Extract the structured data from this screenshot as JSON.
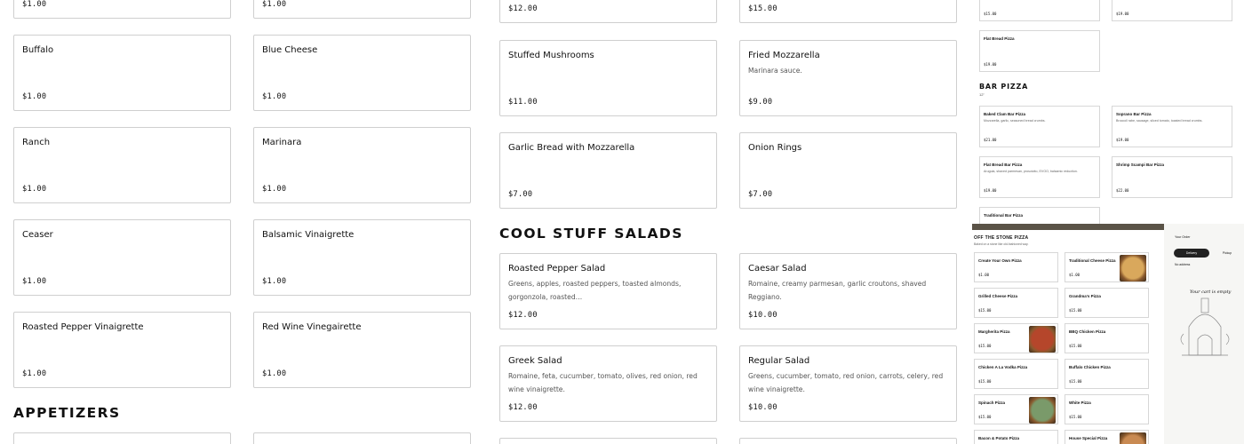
{
  "sauces_col1": [
    {
      "name": "",
      "price": "$1.00"
    },
    {
      "name": "Buffalo",
      "price": "$1.00"
    },
    {
      "name": "Ranch",
      "price": "$1.00"
    },
    {
      "name": "Ceaser",
      "price": "$1.00"
    },
    {
      "name": "Roasted Pepper Vinaigrette",
      "price": "$1.00"
    }
  ],
  "sauces_col2": [
    {
      "name": "",
      "price": "$1.00"
    },
    {
      "name": "Blue Cheese",
      "price": "$1.00"
    },
    {
      "name": "Marinara",
      "price": "$1.00"
    },
    {
      "name": "Balsamic Vinaigrette",
      "price": "$1.00"
    },
    {
      "name": "Red Wine Vinegairette",
      "price": "$1.00"
    }
  ],
  "sides_col1": [
    {
      "name": "",
      "desc": "",
      "price": "$12.00"
    },
    {
      "name": "Stuffed Mushrooms",
      "desc": "",
      "price": "$11.00"
    },
    {
      "name": "Garlic Bread with Mozzarella",
      "desc": "",
      "price": "$7.00"
    }
  ],
  "sides_col2": [
    {
      "name": "",
      "desc": "",
      "price": "$15.00"
    },
    {
      "name": "Fried Mozzarella",
      "desc": "Marinara sauce.",
      "price": "$9.00"
    },
    {
      "name": "Onion Rings",
      "desc": "",
      "price": "$7.00"
    }
  ],
  "salads_title": "COOL STUFF SALADS",
  "salads": [
    {
      "name": "Roasted Pepper Salad",
      "desc": "Greens, apples, roasted peppers, toasted almonds, gorgonzola, roasted…",
      "price": "$12.00"
    },
    {
      "name": "Caesar Salad",
      "desc": "Romaine, creamy parmesan, garlic croutons, shaved Reggiano.",
      "price": "$10.00"
    },
    {
      "name": "Greek Salad",
      "desc": "Romaine, feta, cucumber, tomato, olives, red onion, red wine vinaigrette.",
      "price": "$12.00"
    },
    {
      "name": "Regular Salad",
      "desc": "Greens, cucumber, tomato, red onion, carrots, celery, red wine vinaigrette.",
      "price": "$10.00"
    }
  ],
  "appetizers_title": "APPETIZERS",
  "thumb_top": {
    "prices_row1": [
      "$15.00",
      "$19.00"
    ],
    "flat_bread": {
      "name": "Flat Bread Pizza",
      "price": "$19.00"
    },
    "bar_title": "BAR PIZZA",
    "bar_subtitle": "12\"",
    "bar_items": [
      {
        "name": "Baked Clam Bar Pizza",
        "desc": "Mozzarella, garlic, seasoned bread crumbs.",
        "price": "$21.00"
      },
      {
        "name": "Soprano Bar Pizza",
        "desc": "Broccoli rabe, sausage, sliced tomato, toasted bread crumbs.",
        "price": "$19.00"
      },
      {
        "name": "Flat Bread Bar Pizza",
        "desc": "Arugula, shaved parmesan, prosciutto, EVOO, balsamic reduction.",
        "price": "$19.00"
      },
      {
        "name": "Shrimp Scampi Bar Pizza",
        "desc": "",
        "price": "$22.00"
      },
      {
        "name": "Traditional Bar Pizza",
        "desc": "",
        "price": ""
      }
    ]
  },
  "thumb_bottom": {
    "brand": "OFF THE STONE PIZZA",
    "tagline": "Baked on a stone like old-fashioned way.",
    "order_title": "Your Order",
    "delivery_label": "Delivery",
    "pickup_label": "Pickup",
    "address_label": "No address",
    "cart_empty": "Your cart is empty",
    "items": [
      {
        "name": "Create Your Own Pizza",
        "price": "$1.00"
      },
      {
        "name": "Traditional Cheese Pizza",
        "price": "$1.00"
      },
      {
        "name": "Grilled Cheese Pizza",
        "price": "$15.00"
      },
      {
        "name": "Grandma's Pizza",
        "price": "$15.00"
      },
      {
        "name": "Margherita Pizza",
        "price": "$15.00"
      },
      {
        "name": "BBQ Chicken Pizza",
        "price": "$15.00"
      },
      {
        "name": "Chicken A La Vodka Pizza",
        "price": "$15.00"
      },
      {
        "name": "Buffalo Chicken Pizza",
        "price": "$15.00"
      },
      {
        "name": "Spinach Pizza",
        "price": "$15.00"
      },
      {
        "name": "White Pizza",
        "price": "$15.00"
      },
      {
        "name": "Bacon & Potato Pizza",
        "price": "$15.00"
      },
      {
        "name": "House Special Pizza",
        "price": "$15.00"
      }
    ]
  },
  "colors": {
    "border": "#cfcfcf",
    "text": "#111111",
    "muted": "#555555",
    "dark_pill": "#222222"
  }
}
